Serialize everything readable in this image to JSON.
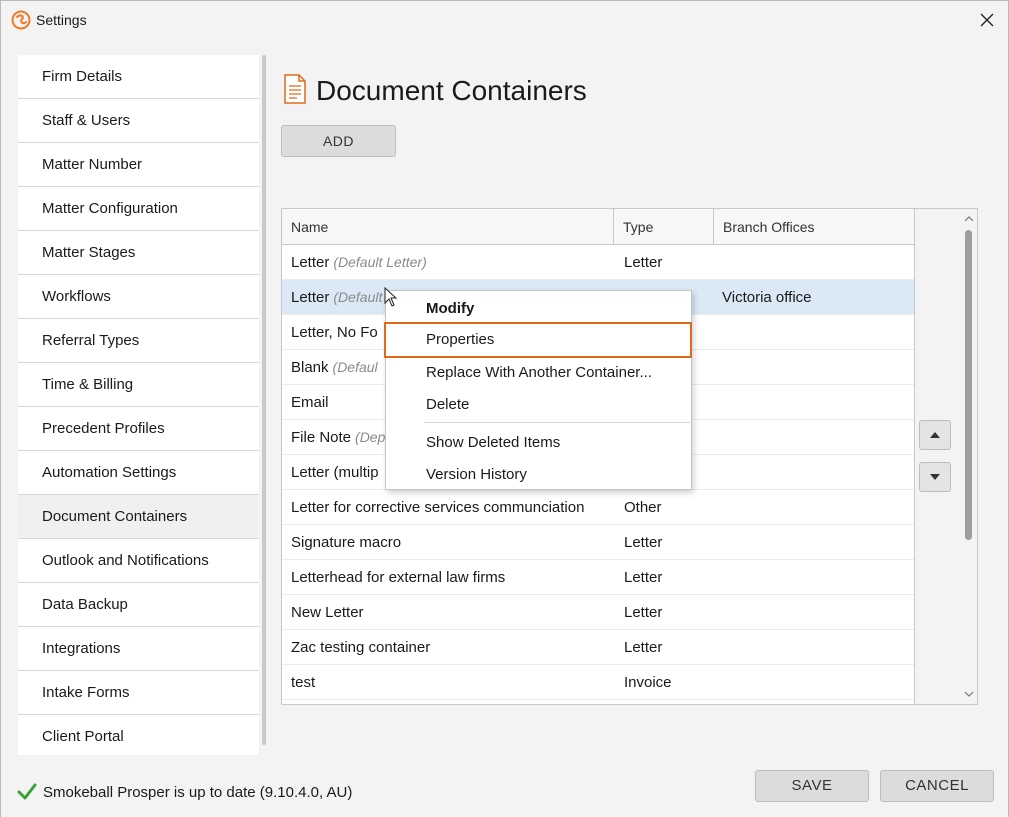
{
  "window": {
    "title": "Settings"
  },
  "sidebar": {
    "items": [
      {
        "label": "Firm Details"
      },
      {
        "label": "Staff & Users"
      },
      {
        "label": "Matter Number"
      },
      {
        "label": "Matter Configuration"
      },
      {
        "label": "Matter Stages"
      },
      {
        "label": "Workflows"
      },
      {
        "label": "Referral Types"
      },
      {
        "label": "Time & Billing"
      },
      {
        "label": "Precedent Profiles"
      },
      {
        "label": "Automation Settings"
      },
      {
        "label": "Document Containers"
      },
      {
        "label": "Outlook and Notifications"
      },
      {
        "label": "Data Backup"
      },
      {
        "label": "Integrations"
      },
      {
        "label": "Intake Forms"
      },
      {
        "label": "Client Portal"
      }
    ],
    "active": "Document Containers"
  },
  "main": {
    "title": "Document Containers",
    "add_label": "ADD",
    "columns": {
      "name": "Name",
      "type": "Type",
      "branch": "Branch Offices"
    },
    "rows": [
      {
        "name": "Letter",
        "note": "(Default Letter)",
        "type": "Letter",
        "branch": ""
      },
      {
        "name": "Letter",
        "note": "(Default",
        "type": "",
        "branch": "Victoria office"
      },
      {
        "name": "Letter, No Fo",
        "note": "",
        "type": "",
        "branch": ""
      },
      {
        "name": "Blank",
        "note": "(Defaul",
        "type": "",
        "branch": ""
      },
      {
        "name": "Email",
        "note": "",
        "type": "",
        "branch": ""
      },
      {
        "name": "File Note",
        "note": "(Dep",
        "type": "",
        "branch": ""
      },
      {
        "name": "Letter (multip",
        "note": "",
        "type": "",
        "branch": ""
      },
      {
        "name": "Letter for corrective services communciation",
        "note": "",
        "type": "Other",
        "branch": ""
      },
      {
        "name": "Signature macro",
        "note": "",
        "type": "Letter",
        "branch": ""
      },
      {
        "name": "Letterhead for external law firms",
        "note": "",
        "type": "Letter",
        "branch": ""
      },
      {
        "name": "New Letter",
        "note": "",
        "type": "Letter",
        "branch": ""
      },
      {
        "name": "Zac testing container",
        "note": "",
        "type": "Letter",
        "branch": ""
      },
      {
        "name": "test",
        "note": "",
        "type": "Invoice",
        "branch": ""
      }
    ]
  },
  "context_menu": {
    "items": [
      {
        "label": "Modify"
      },
      {
        "label": "Properties"
      },
      {
        "label": "Replace With Another Container..."
      },
      {
        "label": "Delete"
      },
      {
        "label": "Show Deleted Items"
      },
      {
        "label": "Version History"
      }
    ],
    "highlighted": "Properties"
  },
  "footer": {
    "status": "Smokeball Prosper is up to date (9.10.4.0, AU)",
    "save_label": "SAVE",
    "cancel_label": "CANCEL"
  },
  "colors": {
    "highlight_outline": "#e06a1b",
    "selected_row": "#dbe8f5",
    "check": "#3aa23a",
    "brand": "#f07a2a"
  }
}
